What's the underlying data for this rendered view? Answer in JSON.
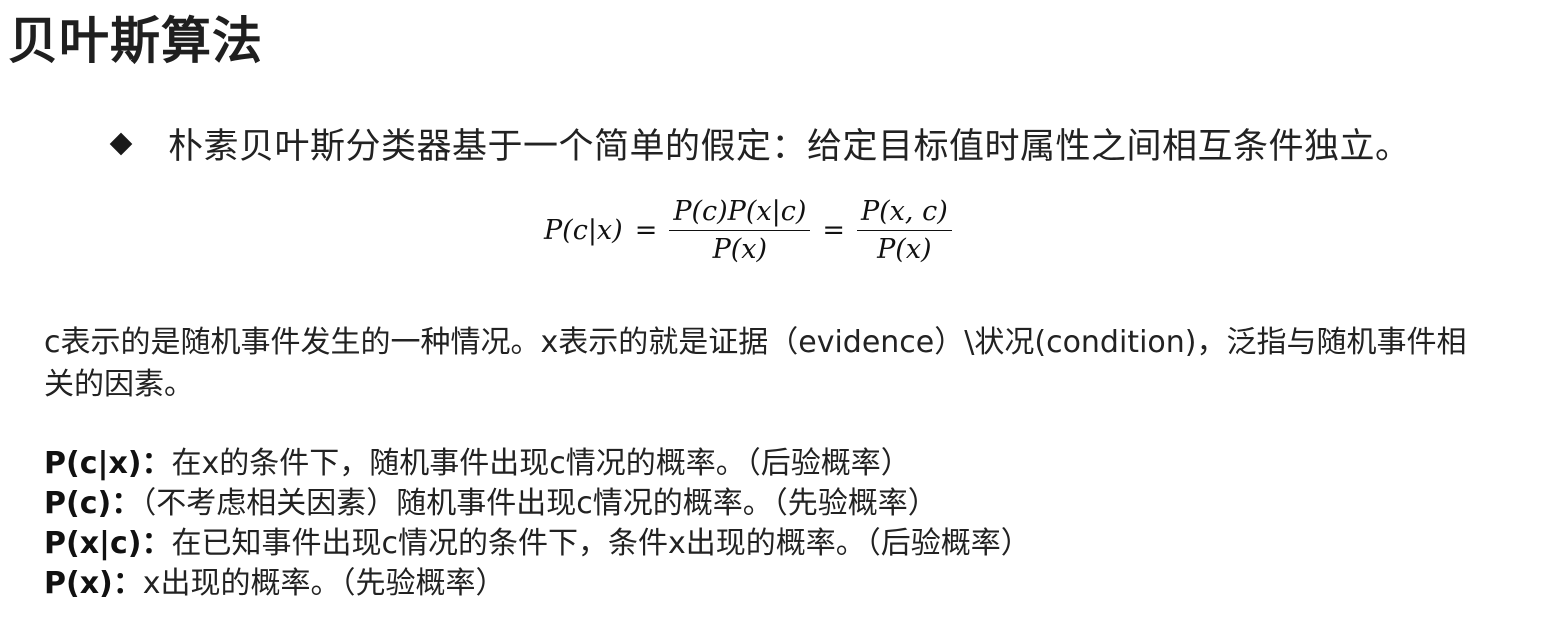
{
  "title": "贝叶斯算法",
  "bullet": "朴素贝叶斯分类器基于一个简单的假定：给定目标值时属性之间相互条件独立。",
  "formula": {
    "lhs": "P(c|x)",
    "eq1": "=",
    "frac1_num": "P(c)P(x|c)",
    "frac1_den": "P(x)",
    "eq2": "=",
    "frac2_num": "P(x, c)",
    "frac2_den": "P(x)"
  },
  "description": "c表示的是随机事件发生的一种情况。x表示的就是证据（evidence）\\状况(condition)，泛指与随机事件相关的因素。",
  "definitions": [
    {
      "term": "P(c|x)：",
      "text": "在x的条件下，随机事件出现c情况的概率。（后验概率）"
    },
    {
      "term": "P(c)：",
      "text": "（不考虑相关因素）随机事件出现c情况的概率。（先验概率）"
    },
    {
      "term": "P(x|c)：",
      "text": "在已知事件出现c情况的条件下，条件x出现的概率。（后验概率）"
    },
    {
      "term": "P(x)：",
      "text": "x出现的概率。（先验概率）"
    }
  ]
}
